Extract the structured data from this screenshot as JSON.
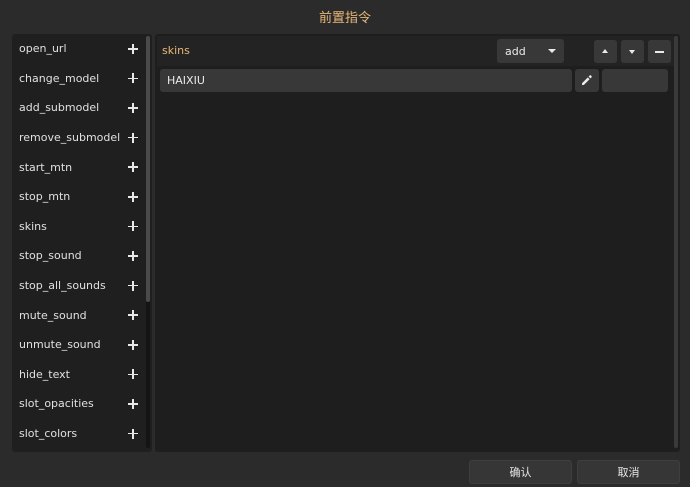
{
  "window": {
    "title": "前置指令"
  },
  "commands": [
    "open_url",
    "change_model",
    "add_submodel",
    "remove_submodel",
    "start_mtn",
    "stop_mtn",
    "skins",
    "stop_sound",
    "stop_all_sounds",
    "mute_sound",
    "unmute_sound",
    "hide_text",
    "slot_opacities",
    "slot_colors"
  ],
  "editor": {
    "command_name": "skins",
    "mode_selected": "add",
    "value": "HAIXIU",
    "extra_value": ""
  },
  "footer": {
    "confirm_label": "确认",
    "cancel_label": "取消"
  },
  "colors": {
    "accent": "#e8b878",
    "background": "#2b2b2b",
    "panel": "#1f1f1f",
    "control": "#383838"
  },
  "icons": {
    "add": "plus-icon",
    "dropdown": "chevron-down-icon",
    "move_up": "triangle-up-icon",
    "move_down": "triangle-down-icon",
    "remove": "minus-icon",
    "edit": "pencil-icon"
  }
}
